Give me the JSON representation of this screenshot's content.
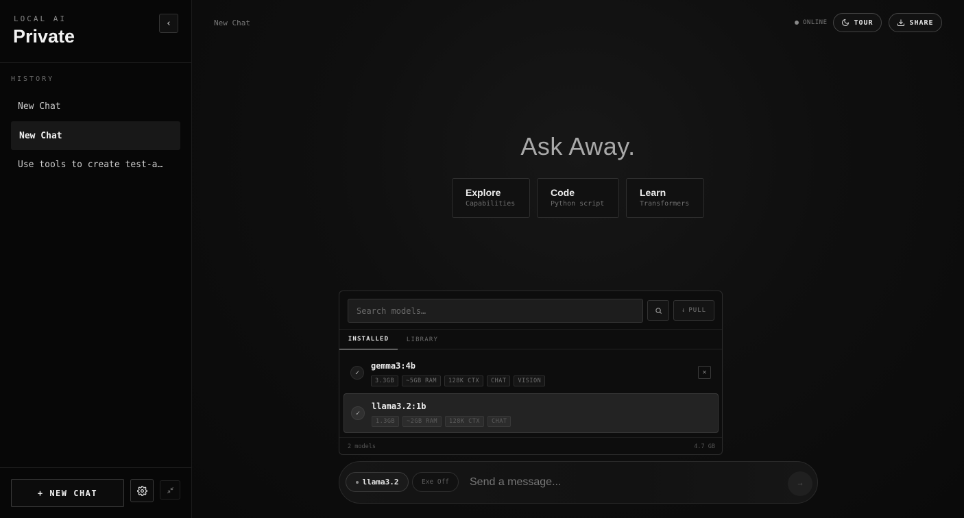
{
  "sidebar": {
    "brand_sub": "LOCAL AI",
    "brand_title": "Private",
    "collapse_icon": "‹",
    "history_label": "HISTORY",
    "items": [
      {
        "label": "New Chat"
      },
      {
        "label": "New Chat"
      },
      {
        "label": "Use tools to create test-a…"
      }
    ],
    "new_chat_label": "+ NEW CHAT"
  },
  "header": {
    "breadcrumb": "New Chat",
    "status": "ONLINE",
    "tour_label": "TOUR",
    "share_label": "SHARE"
  },
  "hero": {
    "title": "Ask Away."
  },
  "suggestions": [
    {
      "title": "Explore",
      "subtitle": "Capabilities"
    },
    {
      "title": "Code",
      "subtitle": "Python script"
    },
    {
      "title": "Learn",
      "subtitle": "Transformers"
    }
  ],
  "models_panel": {
    "search_placeholder": "Search models…",
    "pull_label": "PULL",
    "tabs": [
      {
        "label": "INSTALLED"
      },
      {
        "label": "LIBRARY"
      }
    ],
    "models": [
      {
        "name": "gemma3:4b",
        "tags": [
          "3.3GB",
          "~5GB RAM",
          "128K CTX",
          "CHAT",
          "VISION"
        ]
      },
      {
        "name": "llama3.2:1b",
        "tags": [
          "1.3GB",
          "~2GB RAM",
          "128K CTX",
          "CHAT"
        ]
      }
    ],
    "footer_count": "2 models",
    "footer_size": "4.7 GB"
  },
  "composer": {
    "model_chip": "llama3.2",
    "exec_chip": "Exe Off",
    "placeholder": "Send a message..."
  },
  "colors": {
    "background": "#0b0b0b",
    "sidebar": "#070707",
    "accent_text": "#f2f2f2"
  },
  "icons": {
    "collapse": "chevron-left-icon",
    "theme": "moon-icon",
    "share": "download-icon",
    "settings": "gear-icon",
    "minimize": "collapse-arrows-icon",
    "search": "search-icon",
    "pull": "arrow-down-icon",
    "check": "check-icon",
    "remove": "close-icon",
    "send": "arrow-right-icon"
  }
}
